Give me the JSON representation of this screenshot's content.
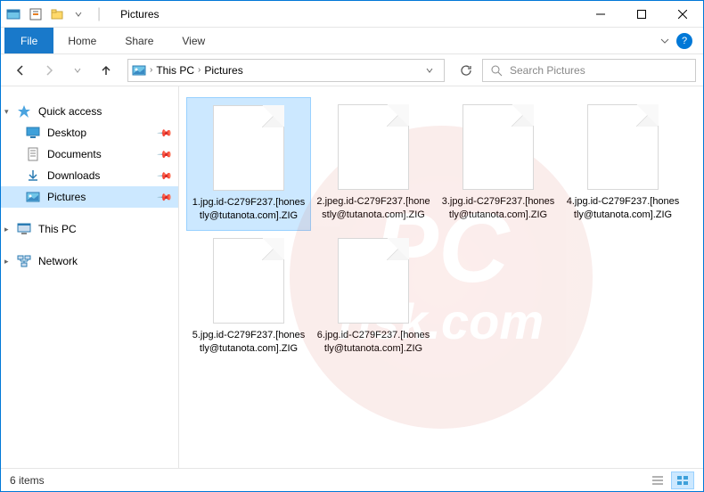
{
  "titlebar": {
    "title": "Pictures"
  },
  "window_controls": {
    "minimize": "━",
    "maximize": "☐",
    "close": "✕"
  },
  "ribbon": {
    "file": "File",
    "tabs": [
      "Home",
      "Share",
      "View"
    ]
  },
  "breadcrumb": {
    "items": [
      "This PC",
      "Pictures"
    ]
  },
  "search": {
    "placeholder": "Search Pictures"
  },
  "sidebar": {
    "quick_access": {
      "label": "Quick access",
      "items": [
        {
          "label": "Desktop",
          "icon": "desktop"
        },
        {
          "label": "Documents",
          "icon": "documents"
        },
        {
          "label": "Downloads",
          "icon": "downloads"
        },
        {
          "label": "Pictures",
          "icon": "pictures",
          "selected": true
        }
      ]
    },
    "this_pc": {
      "label": "This PC"
    },
    "network": {
      "label": "Network"
    }
  },
  "files": [
    {
      "name": "1.jpg.id-C279F237.[honestly@tutanota.com].ZIG",
      "selected": true
    },
    {
      "name": "2.jpeg.id-C279F237.[honestly@tutanota.com].ZIG"
    },
    {
      "name": "3.jpg.id-C279F237.[honestly@tutanota.com].ZIG"
    },
    {
      "name": "4.jpg.id-C279F237.[honestly@tutanota.com].ZIG"
    },
    {
      "name": "5.jpg.id-C279F237.[honestly@tutanota.com].ZIG"
    },
    {
      "name": "6.jpg.id-C279F237.[honestly@tutanota.com].ZIG"
    }
  ],
  "statusbar": {
    "count_label": "6 items"
  },
  "watermark": {
    "line1": "PC",
    "line2": "risk.com"
  }
}
